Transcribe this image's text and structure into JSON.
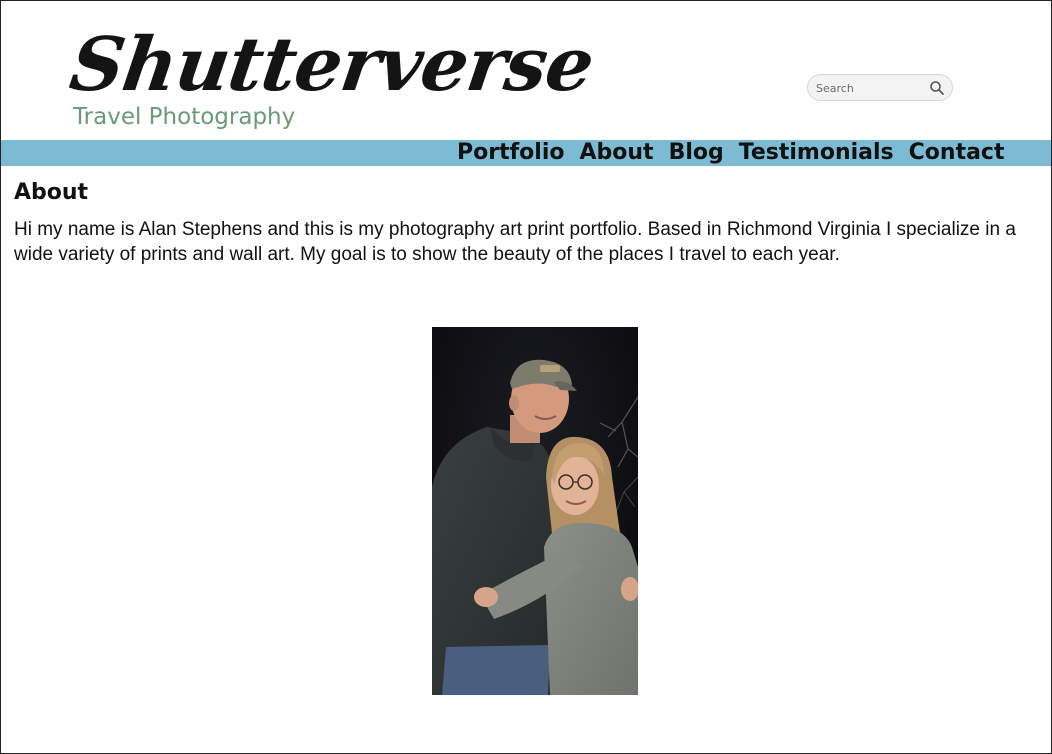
{
  "header": {
    "logo_title": "Shutterverse",
    "logo_subtitle": "Travel Photography",
    "search_placeholder": "Search"
  },
  "nav": {
    "items": [
      "Portfolio",
      "About",
      "Blog",
      "Testimonials",
      "Contact"
    ]
  },
  "main": {
    "heading": "About",
    "body": "Hi my name is Alan Stephens and this is my photography art print portfolio. Based in Richmond Virginia I specialize in a wide variety of prints and wall art. My goal is to show the beauty of the places I travel to each year."
  },
  "colors": {
    "nav_bar": "#7dbad3",
    "subtitle": "#6a9a77"
  }
}
